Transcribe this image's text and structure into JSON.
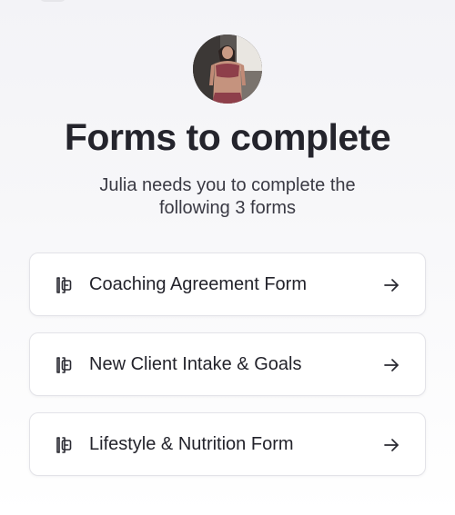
{
  "header": {
    "title": "Forms to complete",
    "subtitle": "Julia needs you to complete the following 3 forms"
  },
  "forms": [
    {
      "label": "Coaching Agreement Form",
      "icon": "form-icon",
      "action_icon": "arrow-right-icon"
    },
    {
      "label": "New Client Intake & Goals",
      "icon": "form-icon",
      "action_icon": "arrow-right-icon"
    },
    {
      "label": "Lifestyle & Nutrition Form",
      "icon": "form-icon",
      "action_icon": "arrow-right-icon"
    }
  ],
  "colors": {
    "text": "#23232b",
    "card_border": "#e3e3e8",
    "background": "#f5f5f8"
  }
}
